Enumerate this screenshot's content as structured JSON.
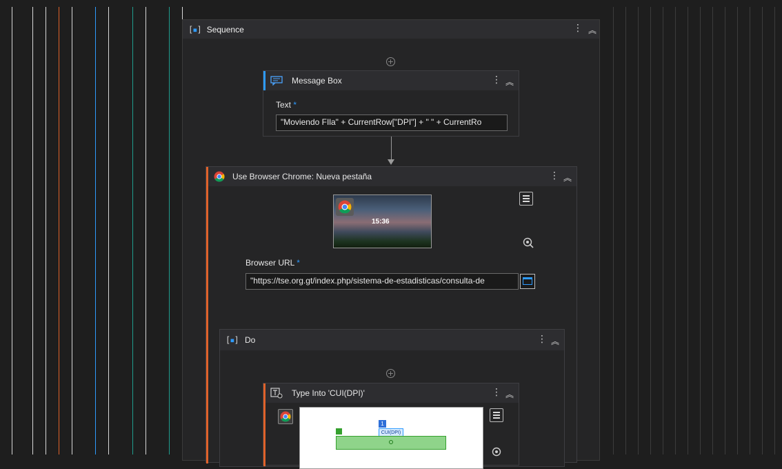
{
  "colors": {
    "orange": "#e0622a",
    "blue": "#2e9bff",
    "teal": "#1f9e8f",
    "background": "#1e1e1e"
  },
  "sequence": {
    "title": "Sequence",
    "icon": "sequence-icon"
  },
  "message_box": {
    "title": "Message Box",
    "text_label": "Text",
    "required_mark": "*",
    "text_value": "\"Moviendo FIla\" + CurrentRow[\"DPI\"] + \" \" + CurrentRo"
  },
  "use_browser": {
    "title": "Use Browser Chrome: Nueva pestaña",
    "preview_time": "15:36",
    "url_label": "Browser URL",
    "required_mark": "*",
    "url_value": "\"https://tse.org.gt/index.php/sistema-de-estadisticas/consulta-de"
  },
  "do_block": {
    "title": "Do"
  },
  "type_into": {
    "title": "Type Into 'CUI(DPI)'",
    "target_badge": "1",
    "target_label": "CUI(DPI)"
  }
}
